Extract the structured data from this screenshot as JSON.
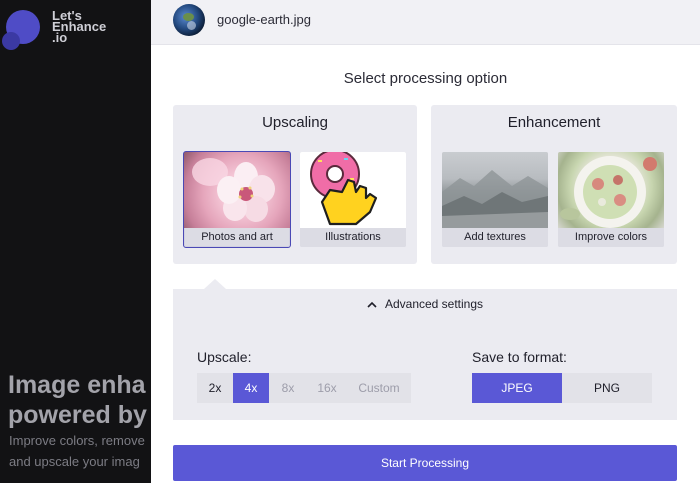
{
  "background": {
    "logo": {
      "line1": "Let's",
      "line2": "Enhance",
      "line3": ".io"
    },
    "hero_title": {
      "line1": "Image enha",
      "line2": "powered by"
    },
    "hero_sub": {
      "line1": "Improve colors, remove",
      "line2": "and upscale your imag"
    }
  },
  "file": {
    "name": "google-earth.jpg",
    "thumb_icon": "earth-thumbnail"
  },
  "section_title": "Select processing option",
  "upscaling": {
    "title": "Upscaling",
    "options": [
      {
        "label": "Photos and art",
        "selected": true
      },
      {
        "label": "Illustrations",
        "selected": false
      }
    ]
  },
  "enhancement": {
    "title": "Enhancement",
    "options": [
      {
        "label": "Add textures",
        "selected": false
      },
      {
        "label": "Improve colors",
        "selected": false
      }
    ]
  },
  "advanced": {
    "toggle_label": "Advanced settings",
    "toggle_icon": "chevron-up-icon",
    "upscale_label": "Upscale:",
    "upscale_options": [
      "2x",
      "4x",
      "8x",
      "16x",
      "Custom"
    ],
    "upscale_selected": "4x",
    "format_label": "Save to format:",
    "format_options": [
      "JPEG",
      "PNG"
    ],
    "format_selected": "JPEG"
  },
  "start_button": "Start Processing",
  "colors": {
    "accent": "#5a58d6",
    "panel": "#ebebf1",
    "selected_outline": "#4a49b5"
  }
}
